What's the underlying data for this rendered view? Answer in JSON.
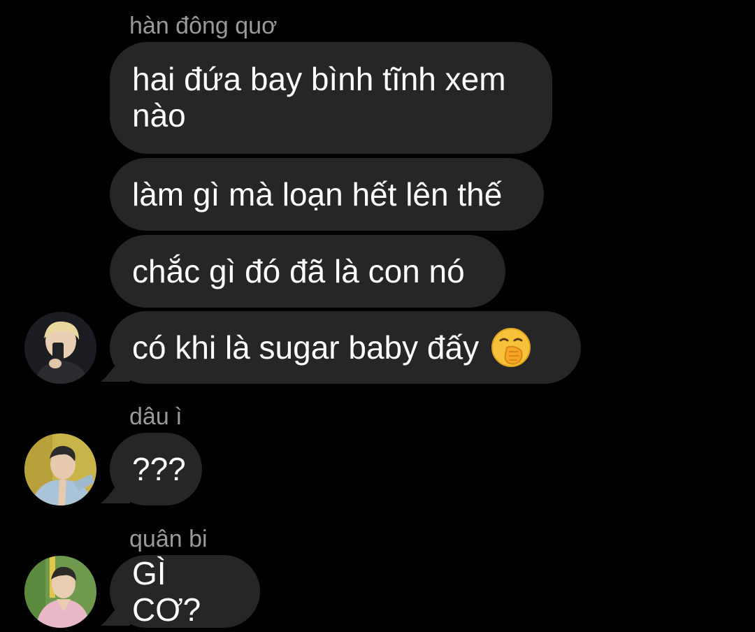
{
  "groups": [
    {
      "sender": "hàn đông quơ",
      "messages": [
        "hai đứa bay bình tĩnh xem nào",
        "làm gì mà loạn hết lên thế",
        "chắc gì đó đã là con nó",
        "có khi là sugar baby đấy"
      ],
      "emoji": "face-with-hand-over-mouth-icon"
    },
    {
      "sender": "dâu ì",
      "messages": [
        "???"
      ]
    },
    {
      "sender": "quân bi",
      "messages": [
        "GÌ CƠ?"
      ]
    }
  ],
  "colors": {
    "background": "#000000",
    "bubble": "#262628",
    "sender_name": "#9a9a9e",
    "message_text": "#ffffff"
  }
}
